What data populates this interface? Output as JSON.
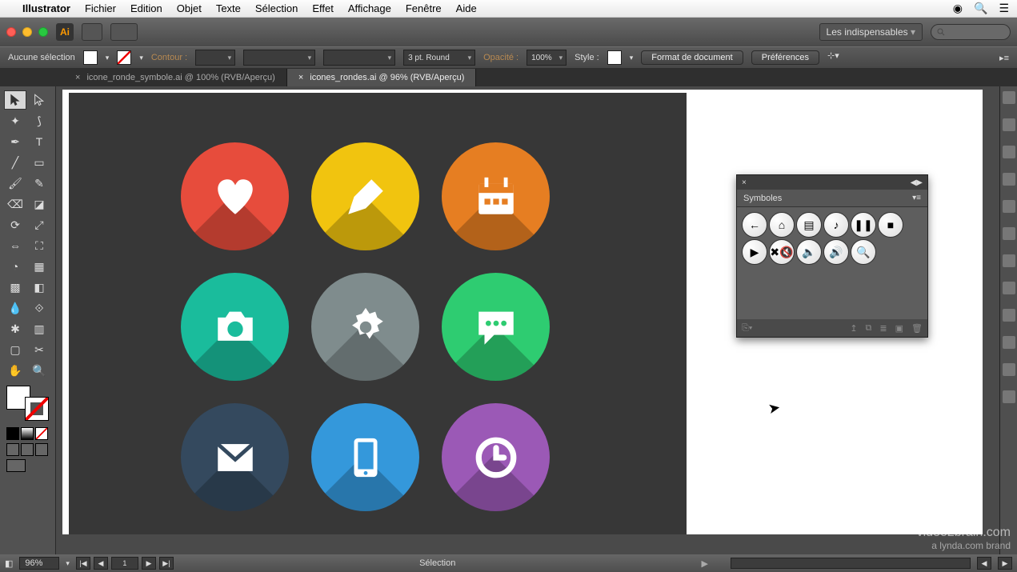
{
  "mac_menu": {
    "apple": "",
    "app": "Illustrator",
    "items": [
      "Fichier",
      "Edition",
      "Objet",
      "Texte",
      "Sélection",
      "Effet",
      "Affichage",
      "Fenêtre",
      "Aide"
    ]
  },
  "app_bar": {
    "workspace_label": "Les indispensables"
  },
  "control_bar": {
    "selection": "Aucune sélection",
    "contour_label": "Contour :",
    "stroke_weight": "3 pt. Round",
    "opacity_label": "Opacité :",
    "opacity_value": "100%",
    "style_label": "Style :",
    "doc_setup": "Format de document",
    "prefs": "Préférences"
  },
  "tabs": [
    {
      "label": "icone_ronde_symbole.ai @ 100% (RVB/Aperçu)",
      "active": false
    },
    {
      "label": "icones_rondes.ai @ 96% (RVB/Aperçu)",
      "active": true
    }
  ],
  "symbols_panel": {
    "title": "Symboles",
    "items_row1": [
      "←",
      "⌂",
      "▤",
      "♪",
      "❚❚",
      "■"
    ],
    "items_row2": [
      "▶",
      "✖🔇",
      "🔈",
      "🔊",
      "🔍"
    ]
  },
  "artwork_icons": [
    {
      "name": "heart",
      "cls": "c-red"
    },
    {
      "name": "pencil",
      "cls": "c-yel"
    },
    {
      "name": "calendar",
      "cls": "c-org"
    },
    {
      "name": "camera",
      "cls": "c-teal"
    },
    {
      "name": "gear",
      "cls": "c-gry"
    },
    {
      "name": "chat",
      "cls": "c-grn"
    },
    {
      "name": "mail",
      "cls": "c-nav"
    },
    {
      "name": "tablet",
      "cls": "c-blu"
    },
    {
      "name": "clock",
      "cls": "c-pur"
    }
  ],
  "status": {
    "zoom": "96%",
    "page": "1",
    "tool": "Sélection"
  },
  "watermark": {
    "l1": "video2brain.com",
    "l2": "a lynda.com brand"
  }
}
